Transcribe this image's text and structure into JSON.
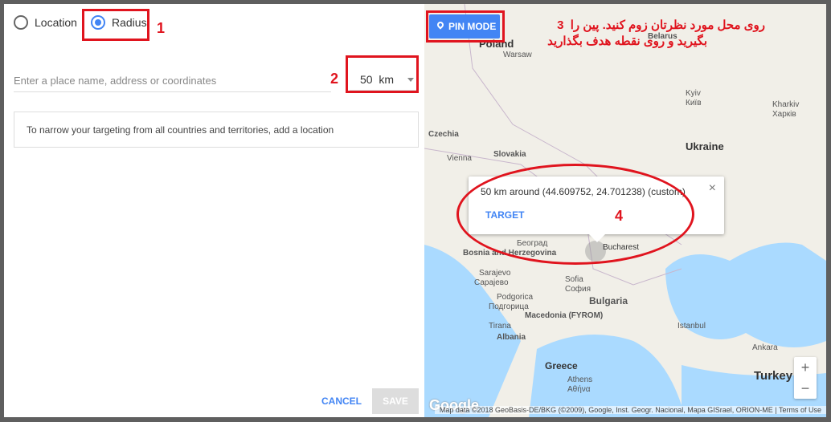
{
  "left": {
    "radio_location": "Location",
    "radio_radius": "Radius",
    "selected": "Radius",
    "place_placeholder": "Enter a place name, address or coordinates",
    "radius_value": "50",
    "radius_unit": "km",
    "note": "To narrow your targeting from all countries and territories, add a location",
    "cancel": "CANCEL",
    "save": "SAVE"
  },
  "annotations": {
    "n1": "1",
    "n2": "2",
    "n3": "3",
    "n4": "4",
    "fa_line1": "روی محل مورد نظرتان زوم کنید. پین را",
    "fa_line2": "بگیرید و روی نقطه هدف بگذارید"
  },
  "map": {
    "pin_mode": "PIN MODE",
    "popup_text": "50 km around (44.609752, 24.701238) (custom)",
    "popup_target": "TARGET",
    "zoom_in": "+",
    "zoom_out": "−",
    "google": "Google",
    "attribution": "Map data ©2018 GeoBasis-DE/BKG (©2009), Google, Inst. Geogr. Nacional, Mapa GISrael, ORION-ME | Terms of Use",
    "labels": [
      "Belarus",
      "Poland",
      "Warsaw",
      "Kyiv",
      "Київ",
      "Kharkiv",
      "Харків",
      "Czechia",
      "Slovakia",
      "Vienna",
      "Ukraine",
      "Bosnia and Herzegovina",
      "Sarajevo",
      "Сарајево",
      "Београд",
      "Bucharest",
      "Sofia",
      "София",
      "Bulgaria",
      "Podgorica",
      "Подгорица",
      "Macedonia (FYROM)",
      "Tirana",
      "Albania",
      "Istanbul",
      "Ankara",
      "Greece",
      "Athens",
      "Αθήνα",
      "Turkey"
    ]
  },
  "colors": {
    "accent": "#4285f4",
    "annotation_red": "#e0141e",
    "sea": "#aadaff"
  }
}
